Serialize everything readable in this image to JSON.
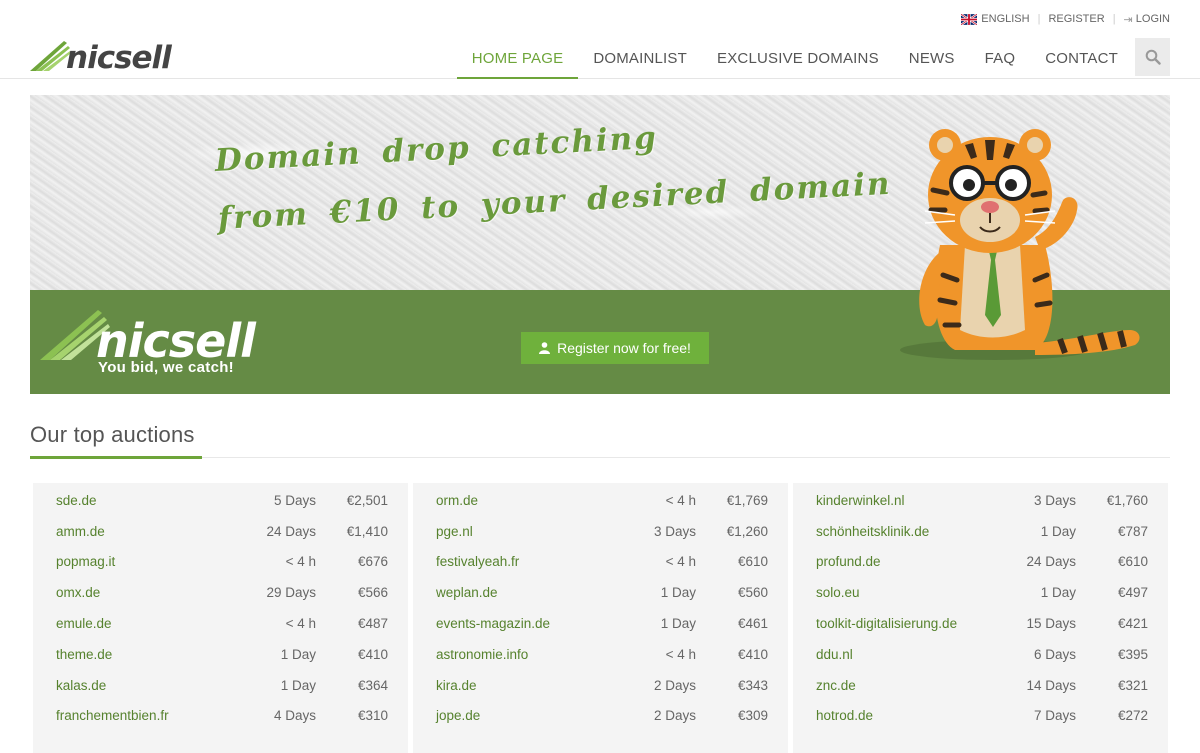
{
  "topbar": {
    "language": "ENGLISH",
    "register": "REGISTER",
    "login": "LOGIN"
  },
  "brand": {
    "name": "nicsell",
    "tagline": "You bid, we catch!",
    "accent_color": "#6ea53a",
    "banner_green": "#658b45"
  },
  "nav": {
    "items": [
      {
        "label": "HOME PAGE",
        "active": true
      },
      {
        "label": "DOMAINLIST",
        "active": false
      },
      {
        "label": "EXCLUSIVE DOMAINS",
        "active": false
      },
      {
        "label": "NEWS",
        "active": false
      },
      {
        "label": "FAQ",
        "active": false
      },
      {
        "label": "CONTACT",
        "active": false
      }
    ],
    "search_icon": "search-icon"
  },
  "banner": {
    "slogan_line1": "Domain drop catching",
    "slogan_line2": "from €10 to your desired domain",
    "cta": "Register now for free!"
  },
  "auctions": {
    "title": "Our top auctions",
    "columns": [
      [
        {
          "domain": "sde.de",
          "time": "5 Days",
          "price": "€2,501"
        },
        {
          "domain": "amm.de",
          "time": "24 Days",
          "price": "€1,410"
        },
        {
          "domain": "popmag.it",
          "time": "< 4 h",
          "price": "€676"
        },
        {
          "domain": "omx.de",
          "time": "29 Days",
          "price": "€566"
        },
        {
          "domain": "emule.de",
          "time": "< 4 h",
          "price": "€487"
        },
        {
          "domain": "theme.de",
          "time": "1 Day",
          "price": "€410"
        },
        {
          "domain": "kalas.de",
          "time": "1 Day",
          "price": "€364"
        },
        {
          "domain": "franchementbien.fr",
          "time": "4 Days",
          "price": "€310"
        }
      ],
      [
        {
          "domain": "orm.de",
          "time": "< 4 h",
          "price": "€1,769"
        },
        {
          "domain": "pge.nl",
          "time": "3 Days",
          "price": "€1,260"
        },
        {
          "domain": "festivalyeah.fr",
          "time": "< 4 h",
          "price": "€610"
        },
        {
          "domain": "weplan.de",
          "time": "1 Day",
          "price": "€560"
        },
        {
          "domain": "events-magazin.de",
          "time": "1 Day",
          "price": "€461"
        },
        {
          "domain": "astronomie.info",
          "time": "< 4 h",
          "price": "€410"
        },
        {
          "domain": "kira.de",
          "time": "2 Days",
          "price": "€343"
        },
        {
          "domain": "jope.de",
          "time": "2 Days",
          "price": "€309"
        }
      ],
      [
        {
          "domain": "kinderwinkel.nl",
          "time": "3 Days",
          "price": "€1,760"
        },
        {
          "domain": "schönheitsklinik.de",
          "time": "1 Day",
          "price": "€787"
        },
        {
          "domain": "profund.de",
          "time": "24 Days",
          "price": "€610"
        },
        {
          "domain": "solo.eu",
          "time": "1 Day",
          "price": "€497"
        },
        {
          "domain": "toolkit-digitalisierung.de",
          "time": "15 Days",
          "price": "€421"
        },
        {
          "domain": "ddu.nl",
          "time": "6 Days",
          "price": "€395"
        },
        {
          "domain": "znc.de",
          "time": "14 Days",
          "price": "€321"
        },
        {
          "domain": "hotrod.de",
          "time": "7 Days",
          "price": "€272"
        }
      ]
    ]
  }
}
